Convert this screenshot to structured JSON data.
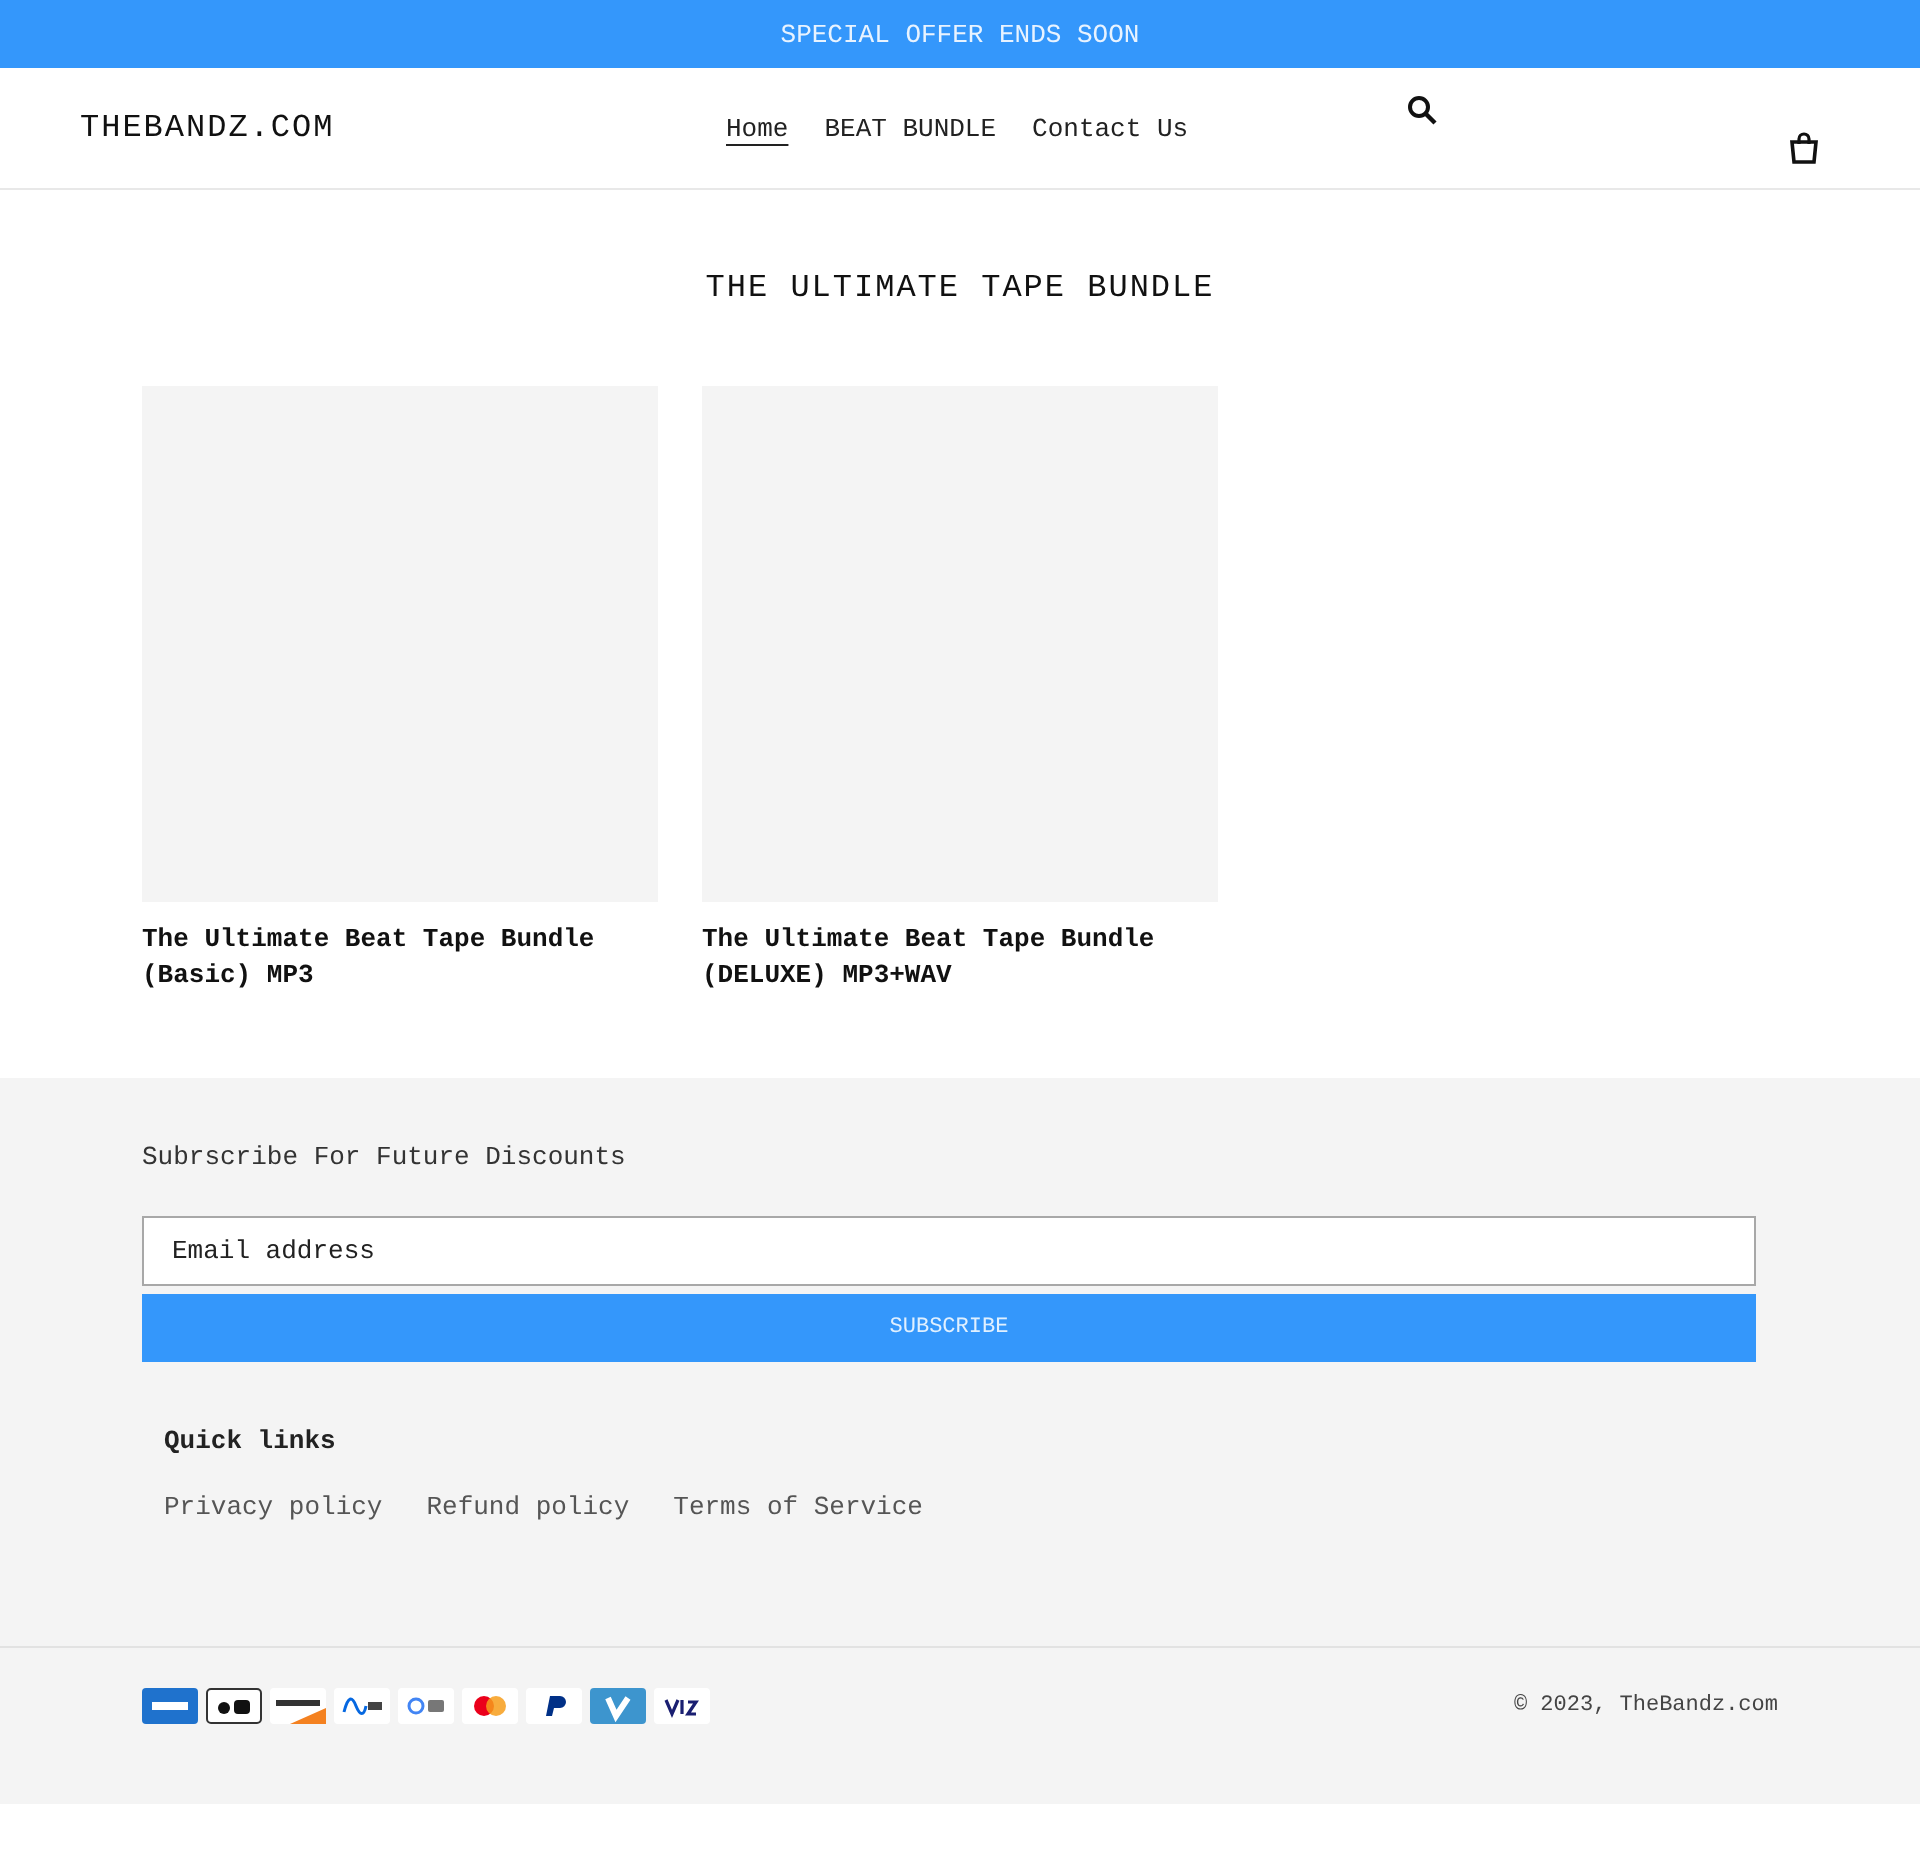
{
  "announcement": "SPECIAL OFFER ENDS SOON",
  "header": {
    "logo": "THEBANDZ.COM",
    "nav": [
      {
        "label": "Home",
        "selected": true
      },
      {
        "label": "BEAT BUNDLE",
        "selected": false
      },
      {
        "label": "Contact Us",
        "selected": false
      }
    ]
  },
  "collection": {
    "title": "THE ULTIMATE TAPE BUNDLE",
    "products": [
      {
        "title": "The Ultimate Beat Tape Bundle (Basic) MP3"
      },
      {
        "title": "The Ultimate Beat Tape Bundle (DELUXE) MP3+WAV"
      }
    ]
  },
  "newsletter": {
    "heading": "Subrscribe For Future Discounts",
    "email": {
      "placeholder": "Email address"
    },
    "button": "SUBSCRIBE"
  },
  "quick_links": {
    "heading": "Quick links",
    "links": [
      "Privacy policy",
      "Refund policy",
      "Terms of Service"
    ]
  },
  "payment_methods": [
    {
      "kind": "amex"
    },
    {
      "kind": "applepay"
    },
    {
      "kind": "discover"
    },
    {
      "kind": "meta"
    },
    {
      "kind": "gpay"
    },
    {
      "kind": "mastercard"
    },
    {
      "kind": "paypal"
    },
    {
      "kind": "venmo"
    },
    {
      "kind": "visa"
    }
  ],
  "copyright": "© 2023, TheBandz.com"
}
